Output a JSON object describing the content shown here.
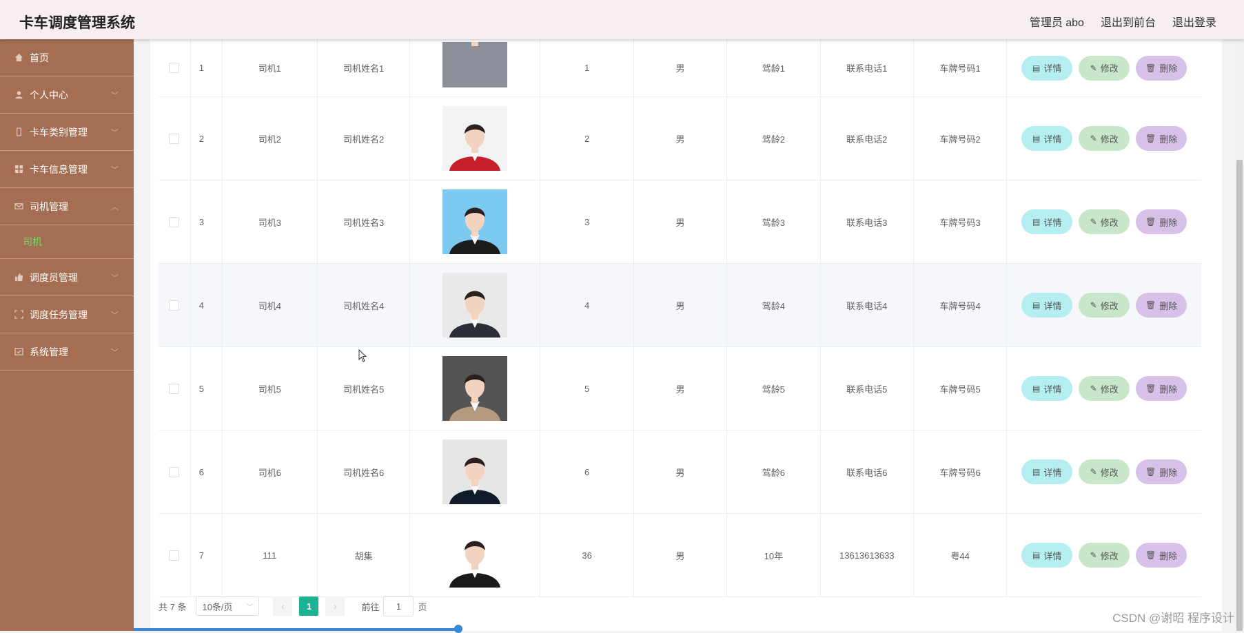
{
  "header": {
    "title": "卡车调度管理系统",
    "admin": "管理员 abo",
    "to_front": "退出到前台",
    "logout": "退出登录"
  },
  "sidebar": {
    "items": [
      {
        "label": "首页",
        "icon": "home-icon"
      },
      {
        "label": "个人中心",
        "icon": "user-icon"
      },
      {
        "label": "卡车类别管理",
        "icon": "phone-icon"
      },
      {
        "label": "卡车信息管理",
        "icon": "grid-icon"
      },
      {
        "label": "司机管理",
        "icon": "mail-icon"
      },
      {
        "label": "司机",
        "icon": ""
      },
      {
        "label": "调度员管理",
        "icon": "thumb-icon"
      },
      {
        "label": "调度任务管理",
        "icon": "crop-icon"
      },
      {
        "label": "系统管理",
        "icon": "check-icon"
      }
    ]
  },
  "table": {
    "rows": [
      {
        "idx": "1",
        "account": "司机1",
        "name": "司机姓名1",
        "age": "1",
        "sex": "男",
        "driving_years": "驾龄1",
        "phone": "联系电话1",
        "plate": "车牌号码1"
      },
      {
        "idx": "2",
        "account": "司机2",
        "name": "司机姓名2",
        "age": "2",
        "sex": "男",
        "driving_years": "驾龄2",
        "phone": "联系电话2",
        "plate": "车牌号码2"
      },
      {
        "idx": "3",
        "account": "司机3",
        "name": "司机姓名3",
        "age": "3",
        "sex": "男",
        "driving_years": "驾龄3",
        "phone": "联系电话3",
        "plate": "车牌号码3"
      },
      {
        "idx": "4",
        "account": "司机4",
        "name": "司机姓名4",
        "age": "4",
        "sex": "男",
        "driving_years": "驾龄4",
        "phone": "联系电话4",
        "plate": "车牌号码4"
      },
      {
        "idx": "5",
        "account": "司机5",
        "name": "司机姓名5",
        "age": "5",
        "sex": "男",
        "driving_years": "驾龄5",
        "phone": "联系电话5",
        "plate": "车牌号码5"
      },
      {
        "idx": "6",
        "account": "司机6",
        "name": "司机姓名6",
        "age": "6",
        "sex": "男",
        "driving_years": "驾龄6",
        "phone": "联系电话6",
        "plate": "车牌号码6"
      },
      {
        "idx": "7",
        "account": "111",
        "name": "胡集",
        "age": "36",
        "sex": "男",
        "driving_years": "10年",
        "phone": "13613613633",
        "plate": "粤44"
      }
    ],
    "buttons": {
      "detail": "详情",
      "edit": "修改",
      "delete": "删除"
    }
  },
  "pagination": {
    "total": "共 7 条",
    "page_size": "10条/页",
    "current_page": "1",
    "goto_prefix": "前往",
    "goto_value": "1",
    "goto_suffix": "页"
  },
  "watermark": "CSDN @谢昭  程序设计",
  "colors": {
    "sidebar_bg": "#a56e52",
    "active_submenu": "#7cd66b",
    "pager_active": "#1bb394",
    "btn_detail": "#b5eef0",
    "btn_edit": "#c8e6c9",
    "btn_delete": "#d7c1e8"
  }
}
